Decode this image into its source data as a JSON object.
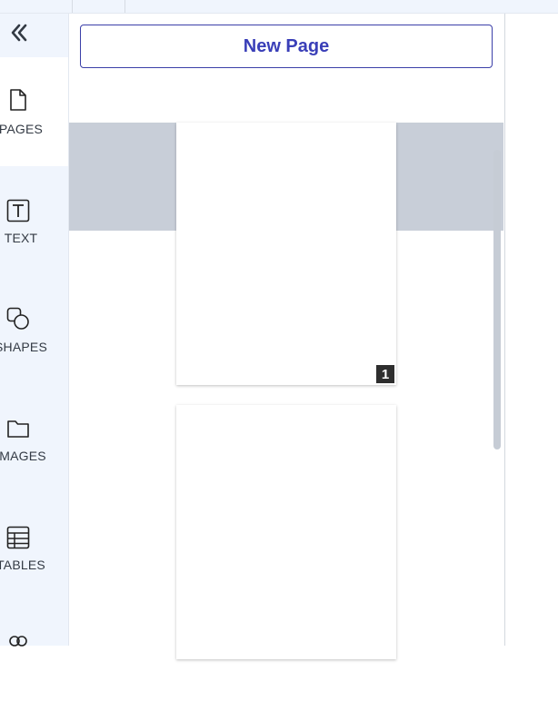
{
  "sidebar": {
    "collapse_icon": "double-chevron-left-icon",
    "items": [
      {
        "label": "PAGES",
        "icon": "page-icon",
        "active": true
      },
      {
        "label": "TEXT",
        "icon": "text-box-icon"
      },
      {
        "label": "SHAPES",
        "icon": "shapes-icon"
      },
      {
        "label": "IMAGES",
        "icon": "folder-icon"
      },
      {
        "label": "TABLES",
        "icon": "table-icon"
      },
      {
        "label": "",
        "icon": "users-icon"
      }
    ]
  },
  "panel": {
    "new_page_label": "New Page",
    "pages": [
      {
        "number": "1"
      },
      {
        "number": ""
      }
    ]
  },
  "colors": {
    "accent": "#3a3fb8",
    "sidebar_bg": "#f0f5fd",
    "highlight": "#c8ced8",
    "badge_bg": "#2e2e2e"
  }
}
